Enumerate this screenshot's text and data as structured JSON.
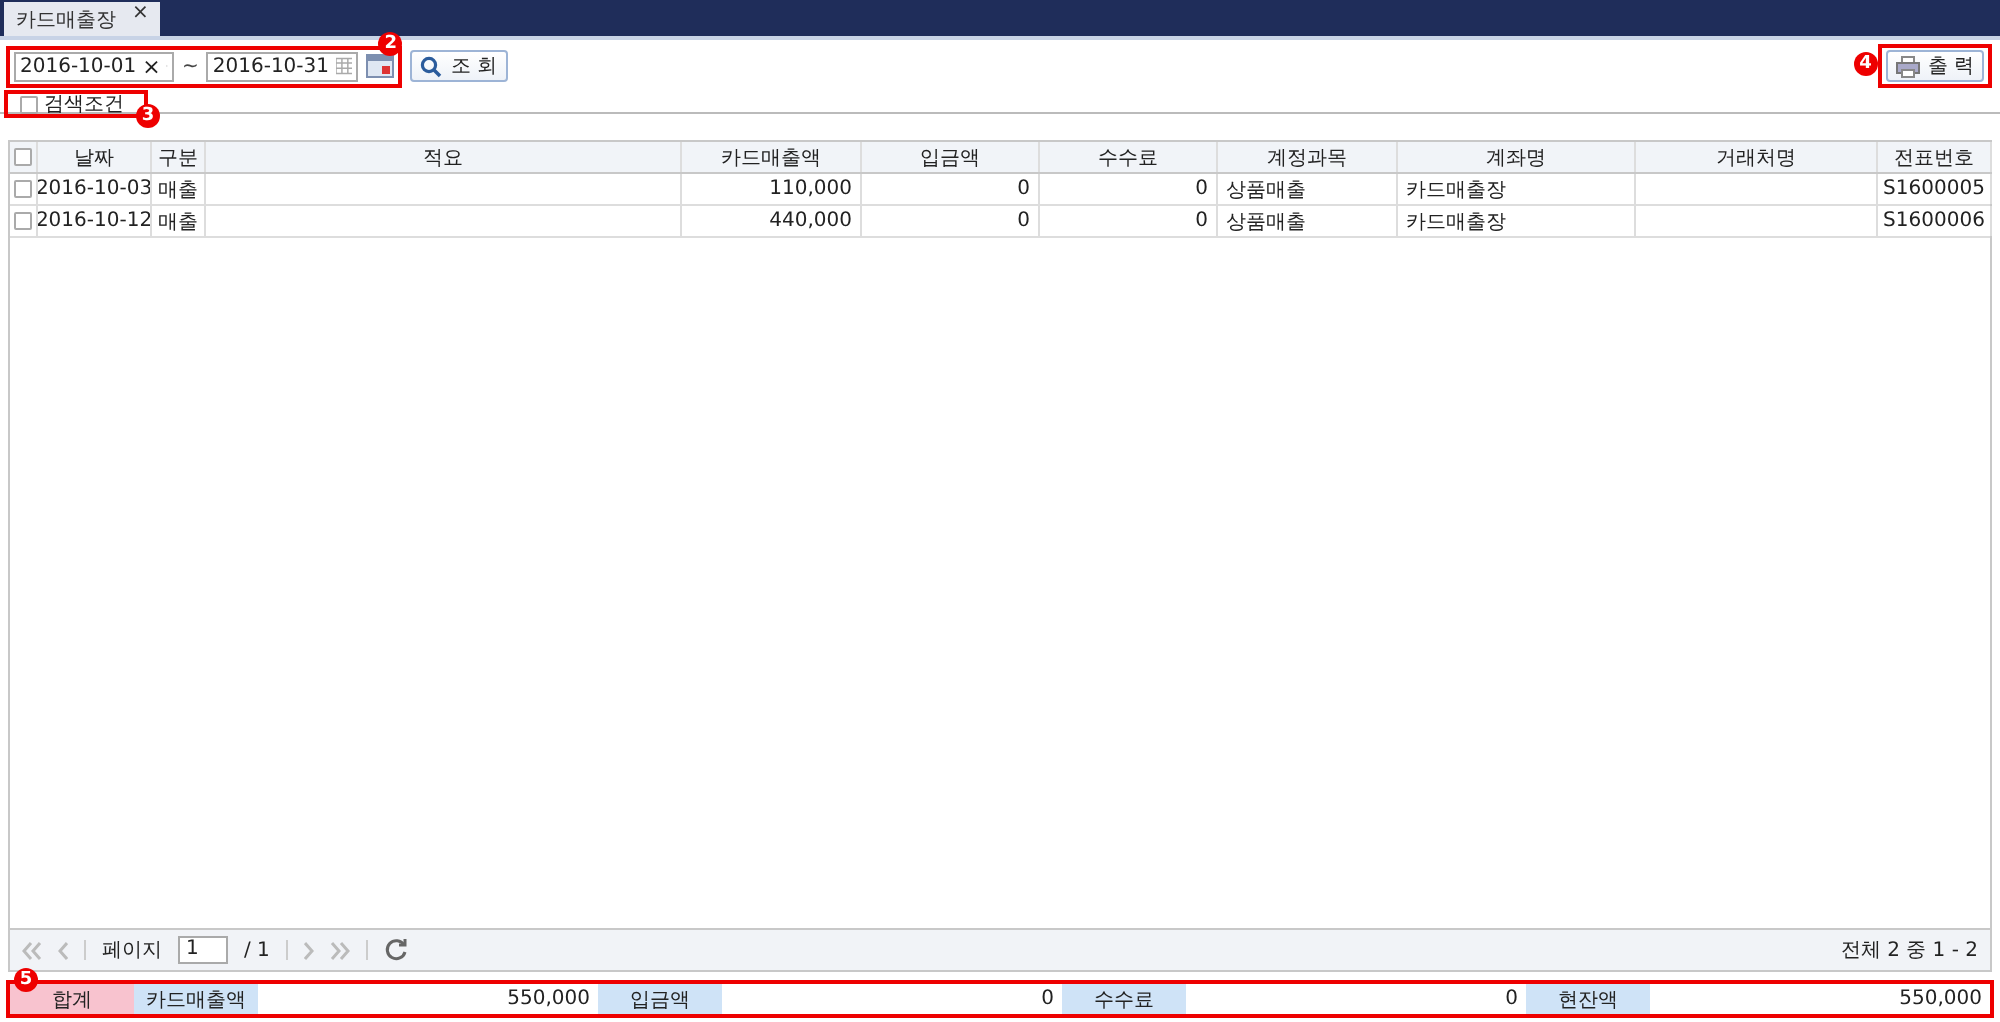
{
  "tabs": [
    {
      "label": "카드매출장",
      "close": "×",
      "selected": true
    }
  ],
  "toolbar": {
    "date_from": "2016-10-01",
    "clear": "×",
    "separator": "~",
    "date_to": "2016-10-31",
    "search_button": "조 회",
    "print_button": "출 력",
    "callout_dates": "2",
    "callout_print": "4"
  },
  "search_condition": {
    "label": "검색조건",
    "checked": false,
    "callout": "3"
  },
  "table": {
    "select_all": false,
    "columns": [
      "날짜",
      "구분",
      "적요",
      "카드매출액",
      "입금액",
      "수수료",
      "계정과목",
      "계좌명",
      "거래처명",
      "전표번호"
    ],
    "rows": [
      {
        "checked": false,
        "cells": [
          "2016-10-03",
          "매출",
          "",
          "110,000",
          "0",
          "0",
          "상품매출",
          "카드매출장",
          "",
          "S1600005"
        ]
      },
      {
        "checked": false,
        "cells": [
          "2016-10-12",
          "매출",
          "",
          "440,000",
          "0",
          "0",
          "상품매출",
          "카드매출장",
          "",
          "S1600006"
        ]
      }
    ]
  },
  "pager": {
    "label": "페이지",
    "page": "1",
    "total": "/ 1",
    "summary": "전체 2 중 1 - 2"
  },
  "totals": {
    "callout": "5",
    "label": "합계",
    "items": [
      {
        "label": "카드매출액",
        "value": "550,000"
      },
      {
        "label": "입금액",
        "value": "0"
      },
      {
        "label": "수수료",
        "value": "0"
      },
      {
        "label": "현잔액",
        "value": "550,000"
      }
    ]
  }
}
